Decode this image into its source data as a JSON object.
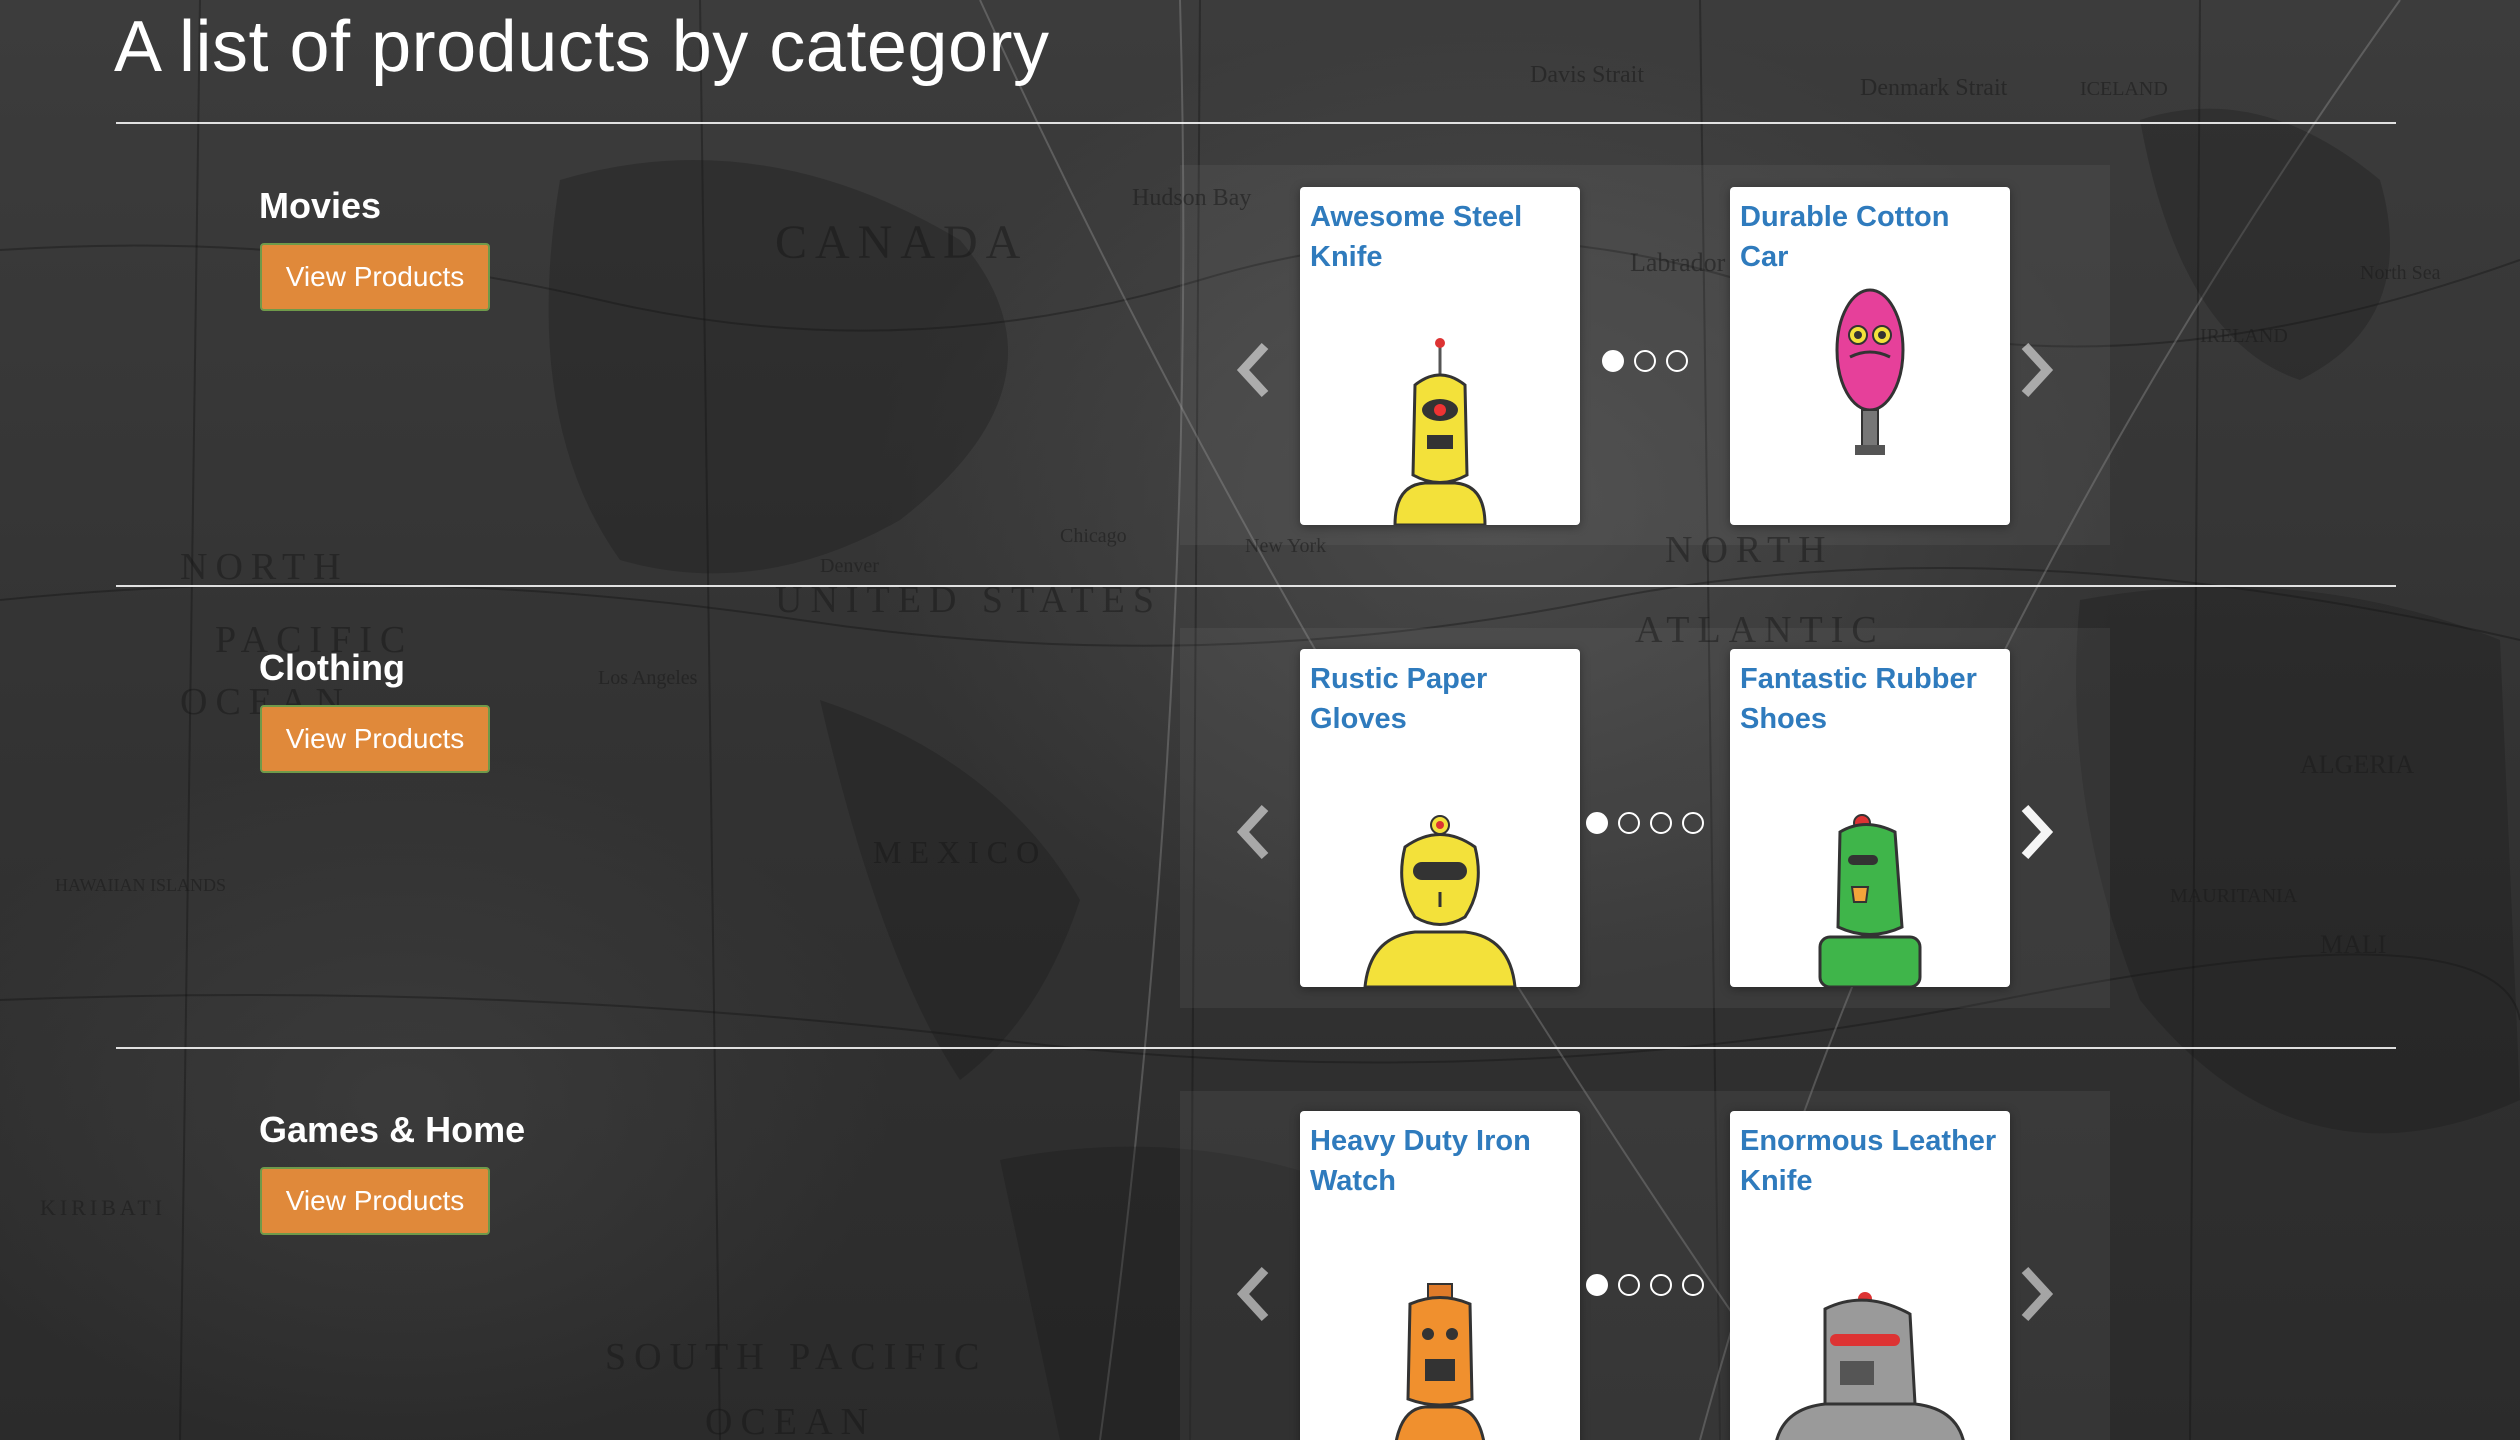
{
  "page": {
    "title": "A list of products by category"
  },
  "map_labels": {
    "canada": "CANADA",
    "north": "NORTH",
    "united_states": "UNITED STATES",
    "pacific": "PACIFIC",
    "ocean": "OCEAN",
    "atlantic": "ATLANTIC",
    "north2": "NORTH",
    "mexico": "MEXICO",
    "south_pacific": "SOUTH PACIFIC",
    "ocean2": "OCEAN",
    "algeria": "ALGERIA",
    "labrador_sea": "Labrador Sea",
    "iceland": "ICELAND",
    "ireland": "IRELAND",
    "kiribati": "KIRIBATI",
    "hudson_bay": "Hudson Bay",
    "davis_strait": "Davis Strait",
    "denmark_strait": "Denmark Strait",
    "chicago": "Chicago",
    "denver": "Denver",
    "los_angeles": "Los Angeles",
    "new_york": "New York",
    "mauritania": "MAURITANIA",
    "mali": "MALI",
    "north_sea": "North Sea",
    "hawaiian": "HAWAIIAN ISLANDS"
  },
  "categories": [
    {
      "name": "Movies",
      "button_label": "View Products",
      "products": [
        {
          "title": "Awesome Steel Knife",
          "robot": "yellow-antenna-robot"
        },
        {
          "title": "Durable Cotton Car",
          "robot": "pink-oval-robot"
        }
      ],
      "dots": 3,
      "active_dot": 0
    },
    {
      "name": "Clothing",
      "button_label": "View Products",
      "products": [
        {
          "title": "Rustic Paper Gloves",
          "robot": "yellow-round-robot"
        },
        {
          "title": "Fantastic Rubber Shoes",
          "robot": "green-robot"
        }
      ],
      "dots": 4,
      "active_dot": 0
    },
    {
      "name": "Games & Home",
      "button_label": "View Products",
      "products": [
        {
          "title": "Heavy Duty Iron Watch",
          "robot": "orange-robot"
        },
        {
          "title": "Enormous Leather Knife",
          "robot": "gray-helmet-robot"
        }
      ],
      "dots": 4,
      "active_dot": 0
    }
  ],
  "colors": {
    "button_bg": "#e0893a",
    "button_border": "#6f9a4a",
    "product_title": "#2f7bbd"
  },
  "icons": {
    "prev": "chevron-left-icon",
    "next": "chevron-right-icon"
  }
}
